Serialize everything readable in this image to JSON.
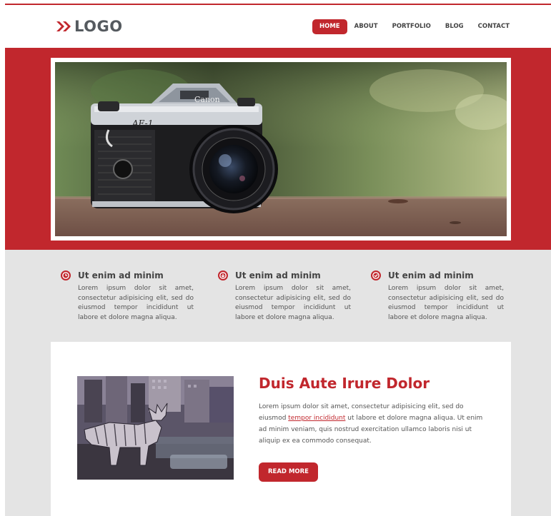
{
  "header": {
    "logo_text": "LOGO",
    "logo_icon": "double-chevron-right-icon",
    "nav": [
      {
        "label": "HOME",
        "active": true
      },
      {
        "label": "ABOUT",
        "active": false
      },
      {
        "label": "PORTFOLIO",
        "active": false
      },
      {
        "label": "BLOG",
        "active": false
      },
      {
        "label": "CONTACT",
        "active": false
      }
    ]
  },
  "hero": {
    "image": "canon-camera-photo",
    "camera_brand": "Canon",
    "camera_model": "AE-1"
  },
  "features": [
    {
      "icon": "clock-icon",
      "title": "Ut enim ad minim",
      "text": "Lorem ipsum dolor sit amet, consectetur adipisicing elit, sed do eiusmod tempor incididunt ut labore et dolore magna aliqua."
    },
    {
      "icon": "arrow-down-circle-icon",
      "title": "Ut enim ad minim",
      "text": "Lorem ipsum dolor sit amet, consectetur adipisicing elit, sed do eiusmod tempor incididunt ut labore et dolore magna aliqua."
    },
    {
      "icon": "check-circle-icon",
      "title": "Ut enim ad minim",
      "text": "Lorem ipsum dolor sit amet, consectetur adipisicing elit, sed do eiusmod tempor incididunt ut labore et dolore magna aliqua."
    }
  ],
  "content": {
    "image": "city-moose-sculpture-photo",
    "title": "Duis Aute Irure Dolor",
    "text_before": "Lorem ipsum dolor sit amet, consectetur adipisicing elit, sed do eiusmod ",
    "link_text": "tempor incididunt",
    "text_after": " ut labore et dolore magna aliqua. Ut enim ad minim veniam, quis nostrud exercitation ullamco laboris nisi ut aliquip ex ea commodo consequat.",
    "button_label": "READ MORE"
  },
  "colors": {
    "accent": "#c1272d",
    "light_gray": "#e4e4e4",
    "text": "#555555"
  }
}
